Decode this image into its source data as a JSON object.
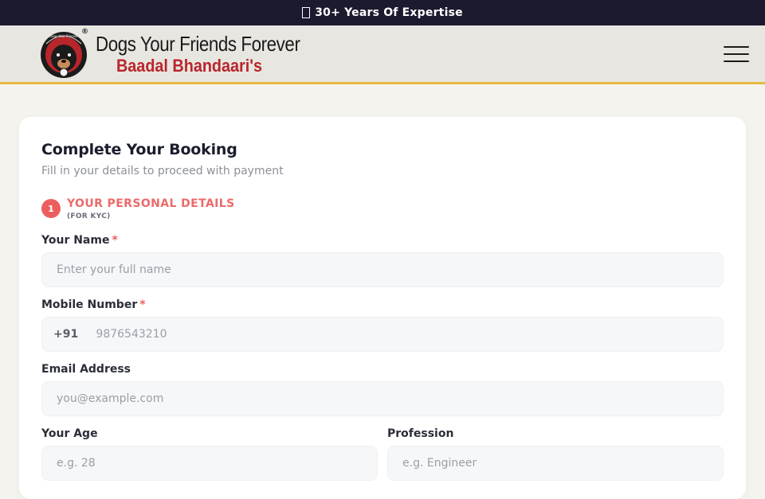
{
  "topbar": {
    "text": "30+ Years Of Expertise",
    "icon": "medal-icon"
  },
  "header": {
    "logo_title": "Dogs Your Friends Forever",
    "logo_subtitle": "Baadal Bhandaari's",
    "logo_ring_text": "Dogs Your Friends Forever",
    "registered_mark": "®"
  },
  "form": {
    "title": "Complete Your Booking",
    "subtitle": "Fill in your details to proceed with payment",
    "section": {
      "number": "1",
      "title": "YOUR PERSONAL DETAILS",
      "note": "(FOR KYC)"
    },
    "name": {
      "label": "Your Name",
      "required": "*",
      "placeholder": "Enter your full name"
    },
    "mobile": {
      "label": "Mobile Number",
      "required": "*",
      "prefix": "+91",
      "placeholder": "9876543210"
    },
    "email": {
      "label": "Email Address",
      "placeholder": "you@example.com"
    },
    "age": {
      "label": "Your Age",
      "placeholder": "e.g. 28"
    },
    "profession": {
      "label": "Profession",
      "placeholder": "e.g. Engineer"
    }
  },
  "colors": {
    "topbar": "#1c1a2e",
    "accent": "#ec5e5e",
    "header_border": "#e6b842",
    "brand_red": "#b8262c"
  }
}
